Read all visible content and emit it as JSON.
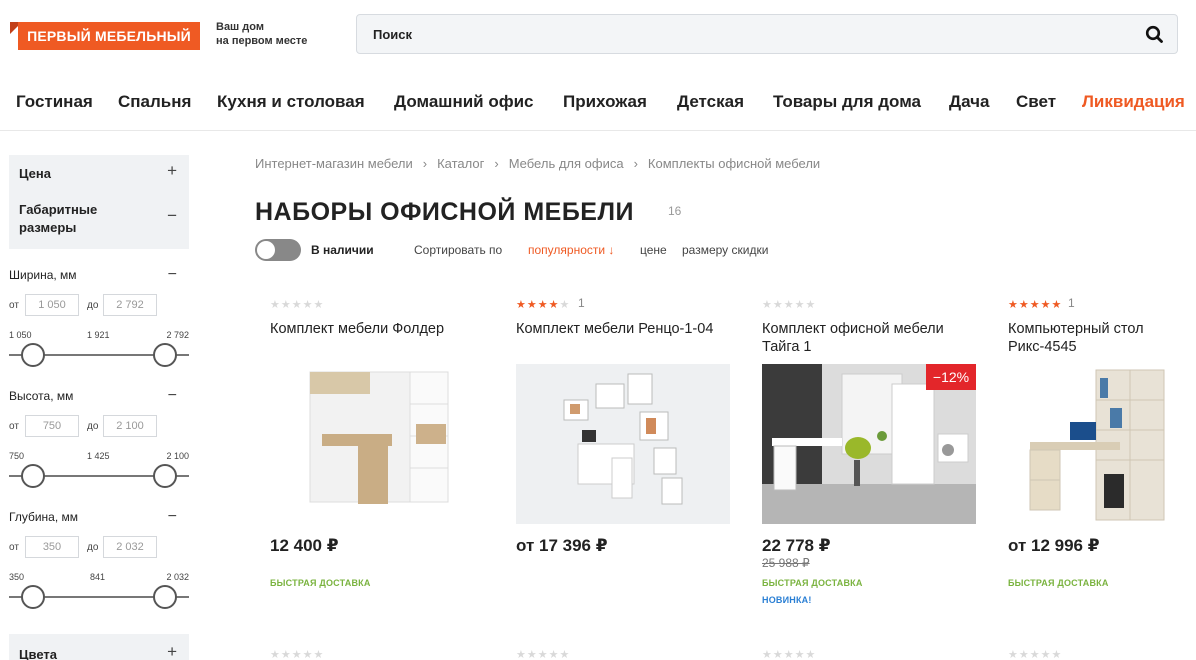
{
  "header": {
    "logo_text": "ПЕРВЫЙ МЕБЕЛЬНЫЙ",
    "tagline_line1": "Ваш дом",
    "tagline_line2": "на первом месте",
    "search_placeholder": "Поиск"
  },
  "nav": [
    "Гостиная",
    "Спальня",
    "Кухня и столовая",
    "Домашний офис",
    "Прихожая",
    "Детская",
    "Товары для дома",
    "Дача",
    "Свет",
    "Ликвидация"
  ],
  "sidebar": {
    "price_label": "Цена",
    "size_label": "Габаритные размеры",
    "width": {
      "label": "Ширина, мм",
      "from_label": "от",
      "to_label": "до",
      "min": "1 050",
      "max": "2 792",
      "scale": [
        "1 050",
        "1 921",
        "2 792"
      ]
    },
    "height": {
      "label": "Высота, мм",
      "from_label": "от",
      "to_label": "до",
      "min": "750",
      "max": "2 100",
      "scale": [
        "750",
        "1 425",
        "2 100"
      ]
    },
    "depth": {
      "label": "Глубина, мм",
      "from_label": "от",
      "to_label": "до",
      "min": "350",
      "max": "2 032",
      "scale": [
        "350",
        "841",
        "2 032"
      ]
    },
    "colors_label": "Цвета",
    "plus": "+",
    "minus": "−"
  },
  "breadcrumb": [
    "Интернет-магазин мебели",
    "Каталог",
    "Мебель для офиса",
    "Комплекты офисной мебели"
  ],
  "breadcrumb_sep": "›",
  "page_title": "НАБОРЫ ОФИСНОЙ МЕБЕЛИ",
  "title_count": "16",
  "filters": {
    "in_stock_label": "В наличии",
    "sort_label": "Сортировать по",
    "sort_options": [
      "популярности ↓",
      "цене",
      "размеру скидки"
    ]
  },
  "products": [
    {
      "name": "Комплект мебели Фолдер",
      "rating": 0,
      "reviews": "",
      "price": "12 400 ₽",
      "old_price": "",
      "badge": "",
      "delivery": "БЫСТРАЯ ДОСТАВКА",
      "new": ""
    },
    {
      "name": "Комплект мебели Ренцо-1-04",
      "rating": 4,
      "reviews": "1",
      "price": "от 17 396 ₽",
      "old_price": "",
      "badge": "",
      "delivery": "",
      "new": ""
    },
    {
      "name": "Комплект офисной мебели Тайга 1",
      "rating": 0,
      "reviews": "",
      "price": "22 778 ₽",
      "old_price": "25 988 ₽",
      "badge": "−12%",
      "delivery": "БЫСТРАЯ ДОСТАВКА",
      "new": "НОВИНКА!"
    },
    {
      "name": "Компьютерный стол Рикс-4545",
      "rating": 5,
      "reviews": "1",
      "price": "от 12 996 ₽",
      "old_price": "",
      "badge": "",
      "delivery": "БЫСТРАЯ ДОСТАВКА",
      "new": ""
    }
  ],
  "colors": {
    "accent": "#ef5a23",
    "delivery": "#7ab33f",
    "new": "#2a7fd4",
    "badge": "#e3262a"
  }
}
